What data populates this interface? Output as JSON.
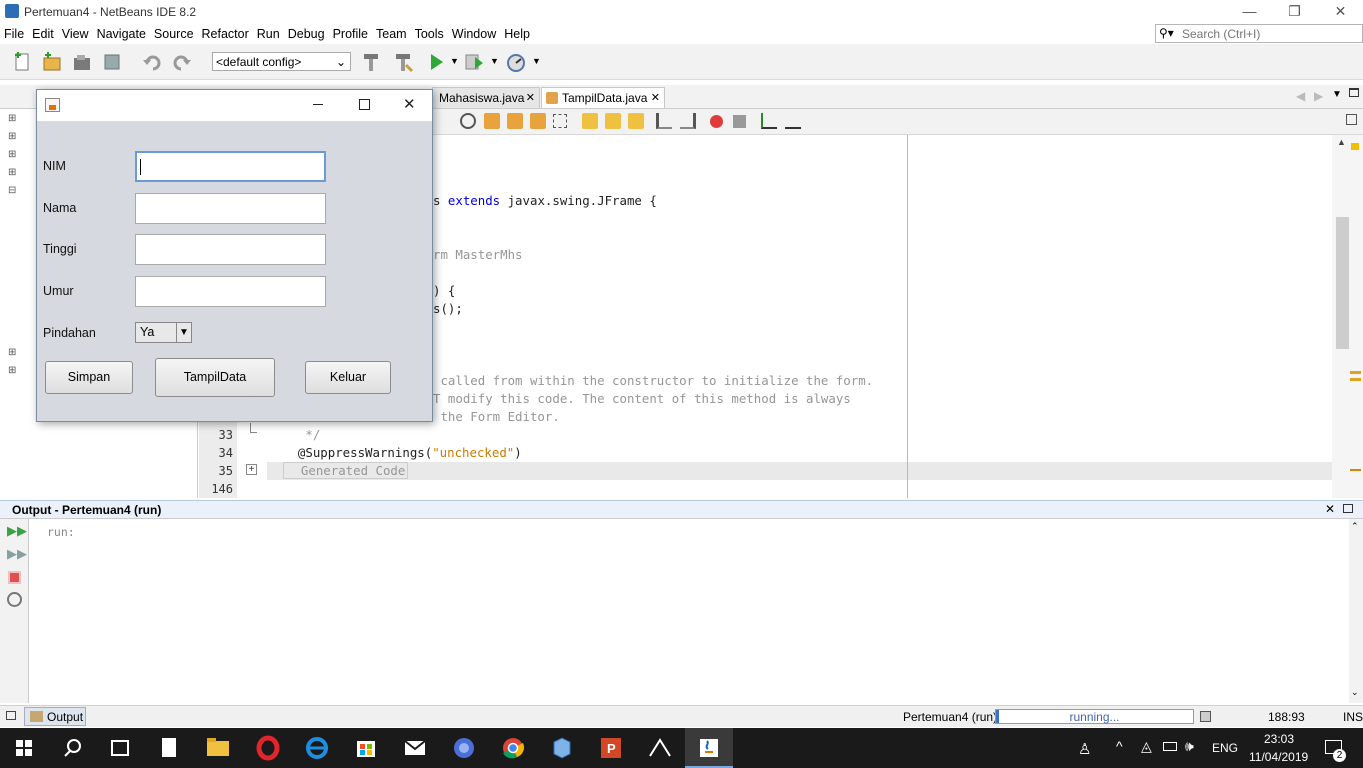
{
  "window": {
    "title": "Pertemuan4 - NetBeans IDE 8.2",
    "min": "—",
    "restore": "❐",
    "close": "✕"
  },
  "menu": [
    "File",
    "Edit",
    "View",
    "Navigate",
    "Source",
    "Refactor",
    "Run",
    "Debug",
    "Profile",
    "Team",
    "Tools",
    "Window",
    "Help"
  ],
  "search": {
    "placeholder": "Search (Ctrl+I)"
  },
  "toolbar": {
    "config": "<default config>"
  },
  "tabs": [
    {
      "label": "Mahasiswa.java",
      "close": "✕"
    },
    {
      "label": "TampilData.java",
      "close": "✕"
    }
  ],
  "code": {
    "lines": [
      {
        "num": "",
        "segments": [
          {
            "t": "s ",
            "c": ""
          },
          {
            "t": "extends",
            "c": "kw"
          },
          {
            "t": " javax.swing.JFrame {",
            "c": ""
          }
        ]
      },
      {
        "num": "",
        "segments": [
          {
            "t": "rm MasterMhs",
            "c": "cm"
          }
        ]
      },
      {
        "num": "",
        "segments": [
          {
            "t": ") {",
            "c": ""
          }
        ]
      },
      {
        "num": "",
        "segments": [
          {
            "t": "s();",
            "c": ""
          }
        ]
      },
      {
        "num": "",
        "segments": [
          {
            "t": " called from within the constructor to initialize the form.",
            "c": "cm"
          }
        ]
      },
      {
        "num": "",
        "segments": [
          {
            "t": "T modify this code. The content of this method is always",
            "c": "cm"
          }
        ]
      },
      {
        "num": "",
        "segments": [
          {
            "t": " the Form Editor.",
            "c": "cm"
          }
        ]
      },
      {
        "num": "33",
        "segments": [
          {
            "t": "   */",
            "c": "cm"
          }
        ]
      },
      {
        "num": "34",
        "segments": [
          {
            "t": "  @SuppressWarnings(",
            "c": ""
          },
          {
            "t": "\"unchecked\"",
            "c": "str"
          },
          {
            "t": ")",
            "c": ""
          }
        ]
      },
      {
        "num": "35",
        "segments": [
          {
            "t": "  Generated Code",
            "c": "cm"
          }
        ]
      },
      {
        "num": "146",
        "segments": []
      }
    ]
  },
  "output": {
    "title": "Output - Pertemuan4 (run)",
    "text": "run:"
  },
  "status": {
    "tab": "Output",
    "project": "Pertemuan4 (run)",
    "progress": "running...",
    "position": "188:93",
    "mode": "INS"
  },
  "taskbar": {
    "lang": "ENG",
    "time": "23:03",
    "date": "11/04/2019",
    "notif": "2"
  },
  "dialog": {
    "fields": [
      {
        "label": "NIM",
        "value": ""
      },
      {
        "label": "Nama",
        "value": ""
      },
      {
        "label": "Tinggi",
        "value": ""
      },
      {
        "label": "Umur",
        "value": ""
      }
    ],
    "pindahan_label": "Pindahan",
    "pindahan_value": "Ya",
    "buttons": {
      "simpan": "Simpan",
      "tampil": "TampilData",
      "keluar": "Keluar"
    }
  }
}
